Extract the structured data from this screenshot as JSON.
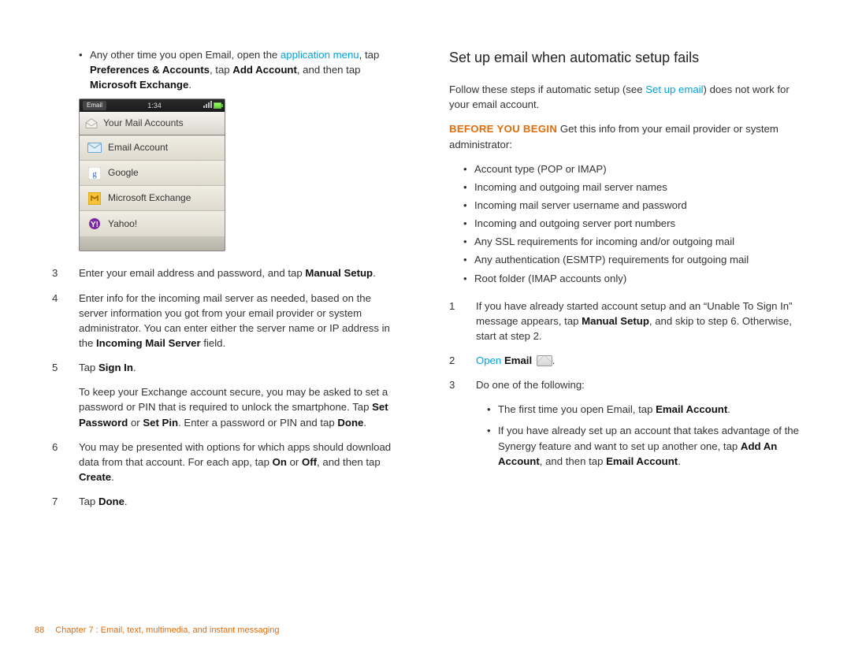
{
  "left": {
    "intro_bullet": {
      "pre": "Any other time you open Email, open the ",
      "link": "application menu",
      "mid": ", tap ",
      "b1": "Preferences & Accounts",
      "mid2": ", tap ",
      "b2": "Add Account",
      "mid3": ", and then tap ",
      "b3": "Microsoft Exchange",
      "end": "."
    },
    "phone": {
      "status_label": "Email",
      "time": "1:34",
      "title": "Your Mail Accounts",
      "rows": [
        "Email Account",
        "Google",
        "Microsoft Exchange",
        "Yahoo!"
      ]
    },
    "steps": {
      "s3": {
        "num": "3",
        "pre": "Enter your email address and password, and tap ",
        "b": "Manual Setup",
        "end": "."
      },
      "s4": {
        "num": "4",
        "pre": "Enter info for the incoming mail server as needed, based on the server information you got from your email provider or system administrator. You can enter either the server name or IP address in the ",
        "b": "Incoming Mail Server",
        "end": " field."
      },
      "s5": {
        "num": "5",
        "pre": "Tap ",
        "b": "Sign In",
        "end": ".",
        "p2_pre": "To keep your Exchange account secure, you may be asked to set a password or PIN that is required to unlock the smartphone. Tap ",
        "p2_b1": "Set Password",
        "p2_mid1": " or ",
        "p2_b2": "Set Pin",
        "p2_mid2": ". Enter a password or PIN and tap ",
        "p2_b3": "Done",
        "p2_end": "."
      },
      "s6": {
        "num": "6",
        "pre": "You may be presented with options for which apps should download data from that account. For each app, tap ",
        "b1": "On",
        "mid": " or ",
        "b2": "Off",
        "mid2": ", and then tap ",
        "b3": "Create",
        "end": "."
      },
      "s7": {
        "num": "7",
        "pre": "Tap ",
        "b": "Done",
        "end": "."
      }
    }
  },
  "right": {
    "heading": "Set up email when automatic setup fails",
    "para1": {
      "pre": "Follow these steps if automatic setup (see ",
      "link": "Set up email",
      "end": ") does not work for your email account."
    },
    "before": {
      "label": "BEFORE YOU BEGIN",
      "text": "  Get this info from your email provider or system administrator:"
    },
    "bullets": [
      "Account type (POP or IMAP)",
      "Incoming and outgoing mail server names",
      "Incoming mail server username and password",
      "Incoming and outgoing server port numbers",
      "Any SSL requirements for incoming and/or outgoing mail",
      "Any authentication (ESMTP) requirements for outgoing mail",
      "Root folder (IMAP accounts only)"
    ],
    "steps": {
      "s1": {
        "num": "1",
        "pre": "If you have already started account setup and an “Unable To Sign In” message appears, tap ",
        "b": "Manual Setup",
        "end": ", and skip to step 6. Otherwise, start at step 2."
      },
      "s2": {
        "num": "2",
        "link": "Open",
        "b": "Email",
        "end": "."
      },
      "s3": {
        "num": "3",
        "text": "Do one of the following:"
      }
    },
    "sub": {
      "a": {
        "pre": "The first time you open Email, tap ",
        "b": "Email Account",
        "end": "."
      },
      "b": {
        "pre": "If you have already set up an account that takes advantage of the Synergy feature and want to set up another one, tap ",
        "b1": "Add An Account",
        "mid": ", and then tap ",
        "b2": "Email Account",
        "end": "."
      }
    }
  },
  "footer": {
    "page": "88",
    "chapter": "Chapter 7 :  Email, text, multimedia, and instant messaging"
  }
}
